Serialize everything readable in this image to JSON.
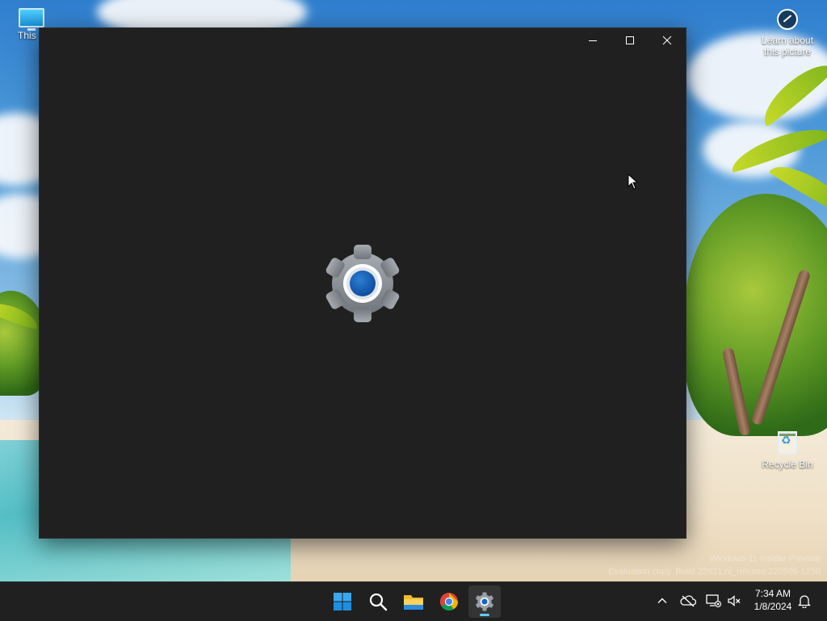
{
  "desktop": {
    "icons": [
      {
        "label": "This P"
      },
      {
        "label": "Learn about this picture"
      },
      {
        "label": "Recycle Bin"
      }
    ],
    "watermark_line1": "Windows 11 Insider Preview",
    "watermark_line2": "Evaluation copy. Build 22621.ni_release.220506-1250"
  },
  "window": {
    "app": "Settings",
    "state": "splash-loading",
    "colors": {
      "background": "#202020",
      "gear": "#8f959b",
      "gear_center": "#1565c0"
    }
  },
  "taskbar": {
    "apps": [
      {
        "icon": "windows-start-icon"
      },
      {
        "icon": "search-icon"
      },
      {
        "icon": "file-explorer-icon"
      },
      {
        "icon": "chrome-icon"
      },
      {
        "icon": "settings-gear-icon",
        "active": true
      }
    ],
    "tray": [
      "chevron-up-icon",
      "onedrive-offline-icon",
      "network-disconnected-icon",
      "volume-muted-icon",
      "notification-bell-icon"
    ],
    "time": "7:34 AM",
    "date": "1/8/2024"
  }
}
